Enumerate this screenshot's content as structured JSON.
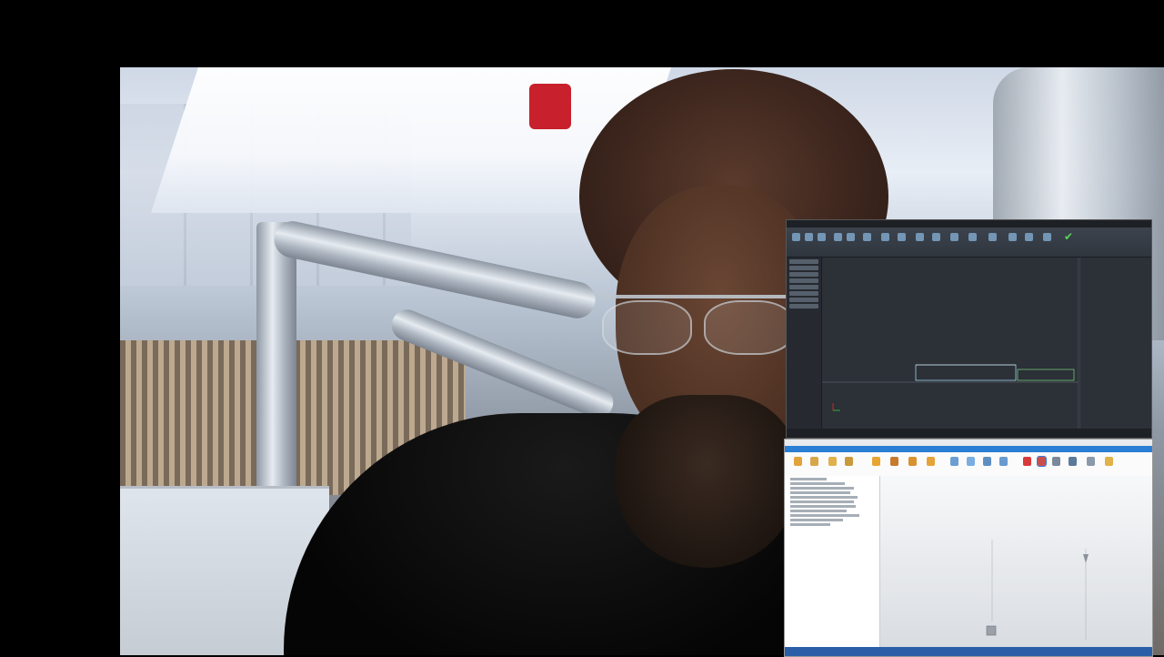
{
  "webcam": {
    "description_icon": "webcam-feed"
  },
  "cad_window": {
    "title": "",
    "status_text": "",
    "colors": {
      "background": "#2b2f36",
      "geometry": "#9fd0e8",
      "accent": "#5ad35a"
    },
    "icons": [
      "checkmark-icon"
    ]
  },
  "cam_window": {
    "title": "",
    "status_text": "",
    "colors": {
      "tab_bar": "#2a7fd4",
      "status_bar": "#2a5fa8"
    }
  }
}
